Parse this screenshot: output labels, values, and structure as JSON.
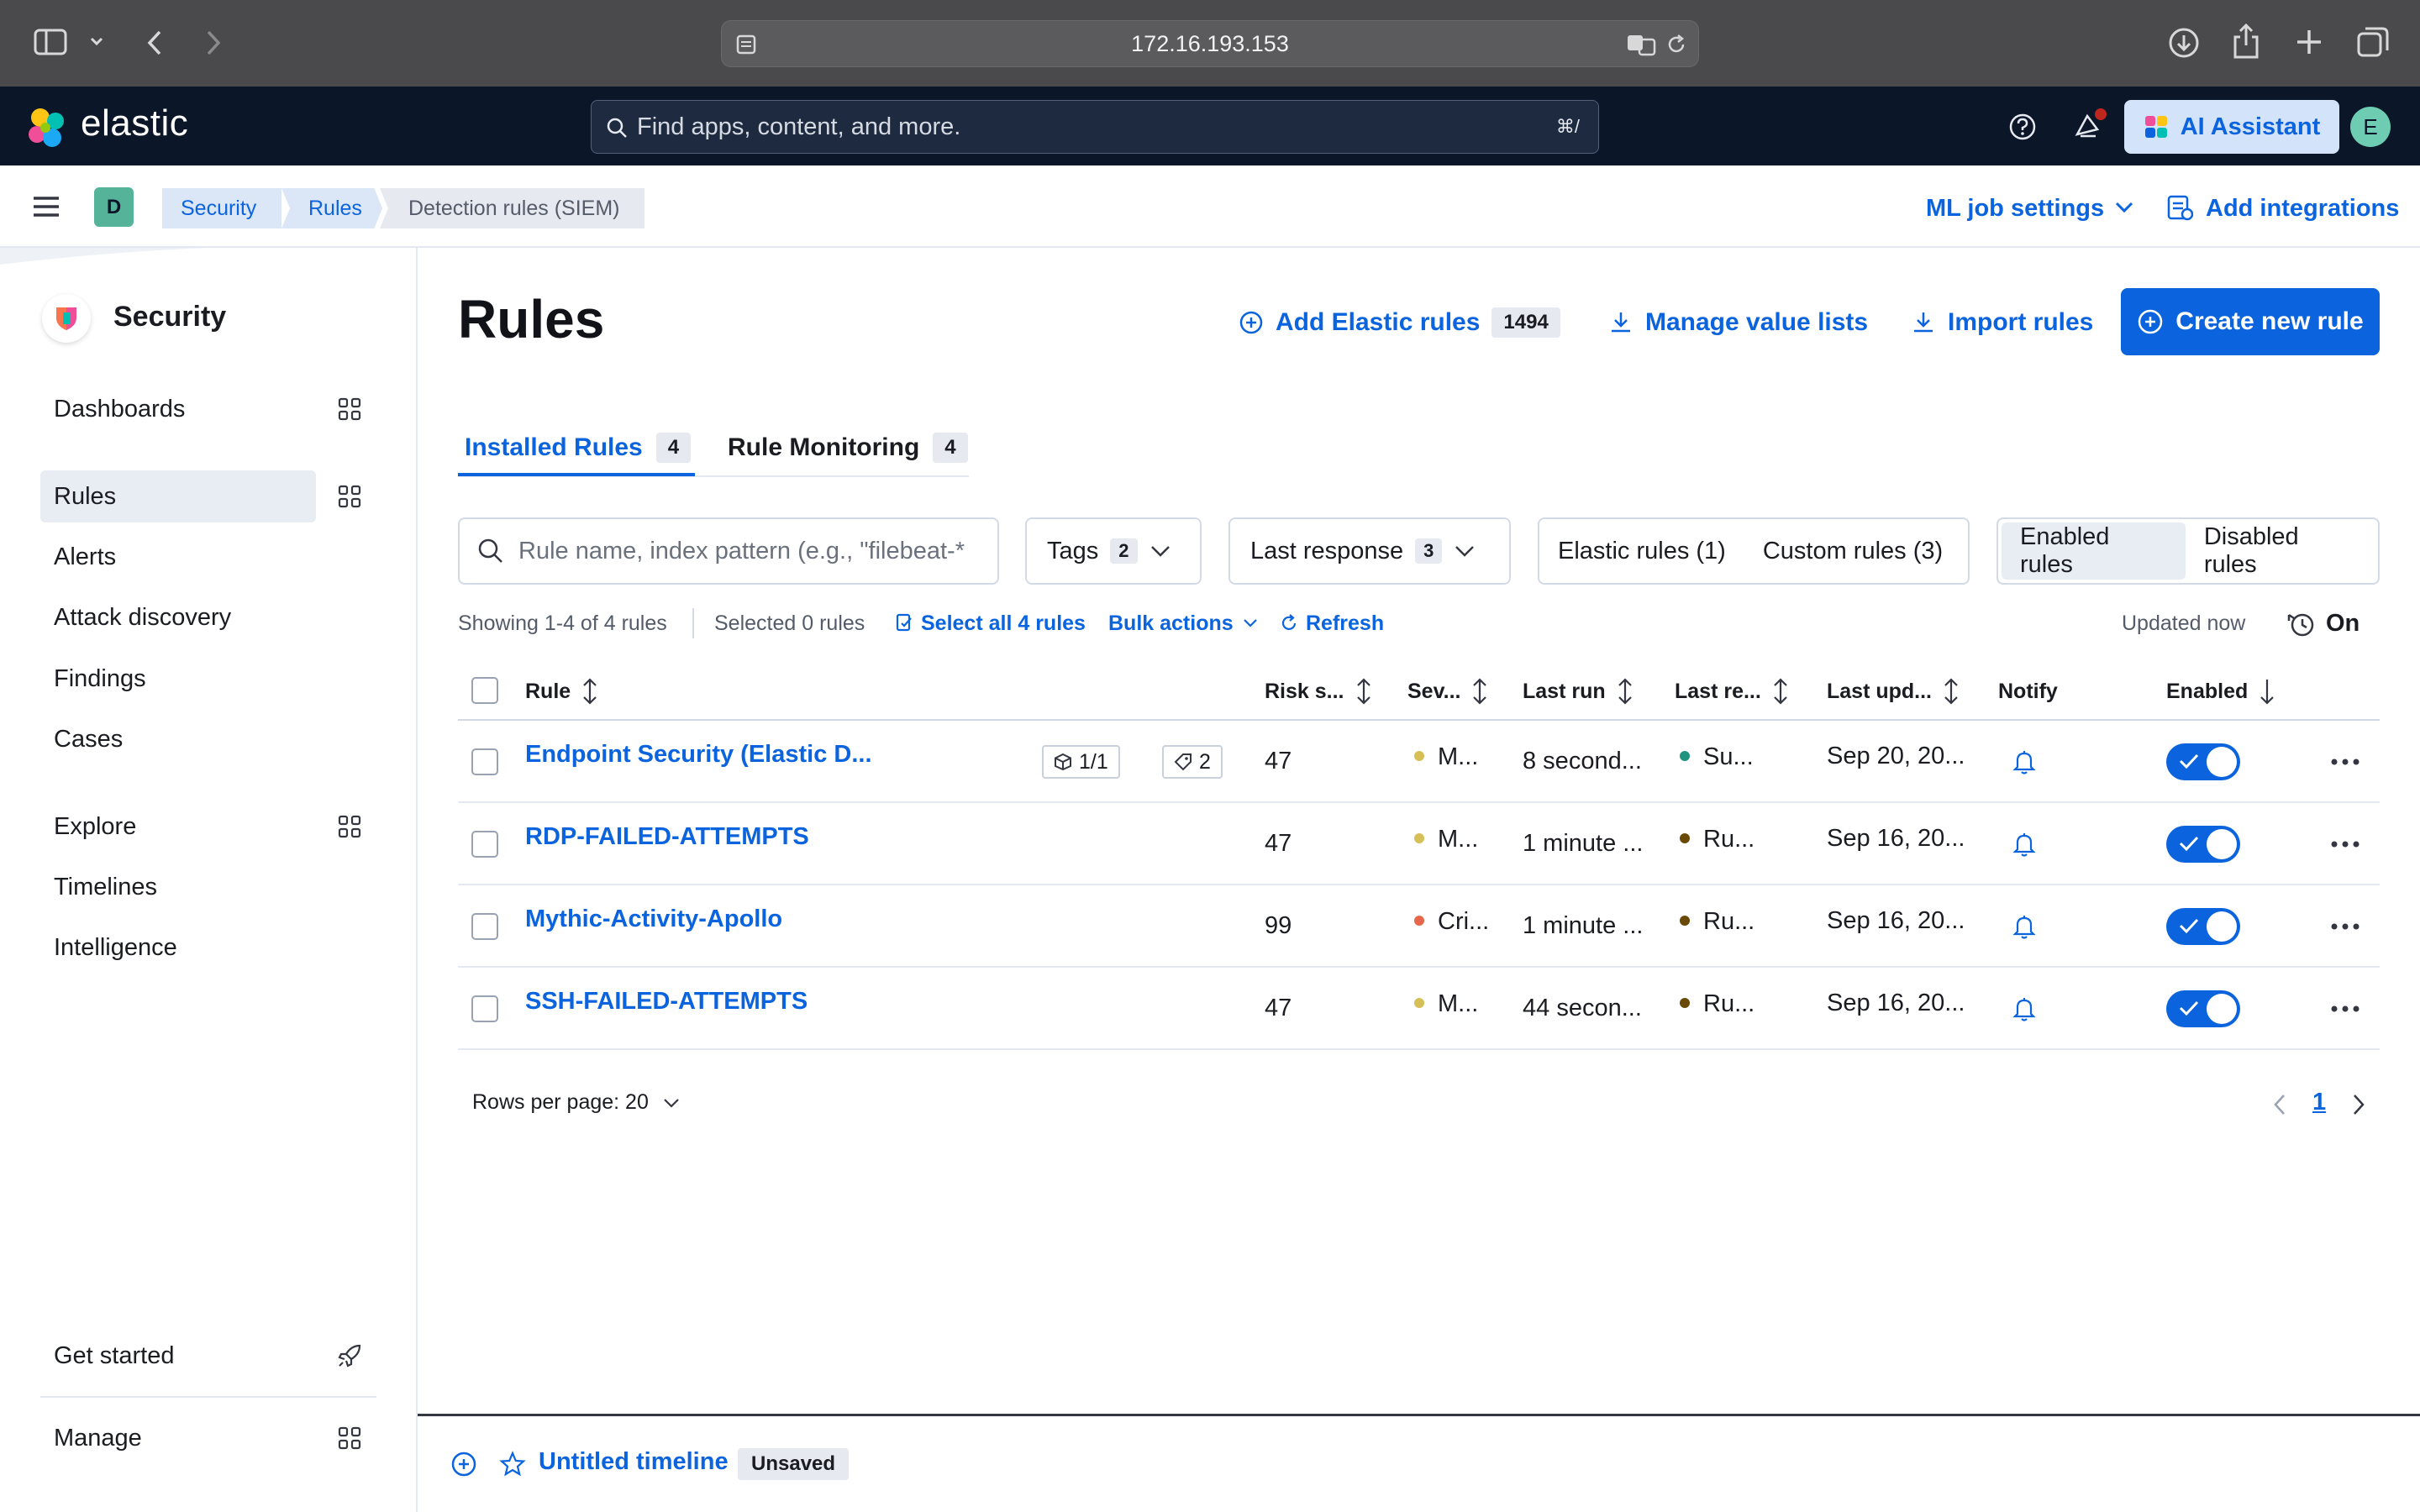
{
  "browser": {
    "url": "172.16.193.153"
  },
  "header": {
    "brand": "elastic",
    "search_placeholder": "Find apps, content, and more.",
    "search_shortcut": "⌘/",
    "ai_assistant_label": "AI Assistant",
    "user_initial": "E"
  },
  "breadcrumb_bar": {
    "space_initial": "D",
    "crumbs": [
      "Security",
      "Rules",
      "Detection rules (SIEM)"
    ],
    "ml_job_settings": "ML job settings",
    "add_integrations": "Add integrations"
  },
  "sidebar": {
    "title": "Security",
    "items": [
      "Dashboards",
      "Rules",
      "Alerts",
      "Attack discovery",
      "Findings",
      "Cases",
      "Explore",
      "Timelines",
      "Intelligence"
    ],
    "footer_items": [
      "Get started",
      "Manage"
    ],
    "active": "Rules"
  },
  "page": {
    "title": "Rules",
    "add_elastic_rules": "Add Elastic rules",
    "add_elastic_rules_count": "1494",
    "manage_value_lists": "Manage value lists",
    "import_rules": "Import rules",
    "create_new_rule": "Create new rule"
  },
  "tabs": [
    {
      "label": "Installed Rules",
      "count": "4",
      "active": true
    },
    {
      "label": "Rule Monitoring",
      "count": "4",
      "active": false
    }
  ],
  "filters": {
    "search_placeholder": "Rule name, index pattern (e.g., \"filebeat-*",
    "tags_label": "Tags",
    "tags_count": "2",
    "last_response_label": "Last response",
    "last_response_count": "3",
    "elastic_rules": "Elastic rules (1)",
    "custom_rules": "Custom rules (3)",
    "enabled_rules": "Enabled rules",
    "disabled_rules": "Disabled rules"
  },
  "utility": {
    "showing": "Showing 1-4 of 4 rules",
    "selected": "Selected 0 rules",
    "select_all": "Select all 4 rules",
    "bulk_actions": "Bulk actions",
    "refresh": "Refresh",
    "updated": "Updated now",
    "auto_refresh": "On"
  },
  "table": {
    "columns": [
      "Rule",
      "Risk s...",
      "Sev...",
      "Last run",
      "Last re...",
      "Last upd...",
      "Notify",
      "Enabled"
    ],
    "rows": [
      {
        "rule": "Endpoint Security (Elastic D...",
        "integrations": "1/1",
        "tags": "2",
        "risk": "47",
        "severity": "M...",
        "severity_color": "#d6bf57",
        "last_run": "8 second...",
        "last_response": "Su...",
        "response_color": "#209280",
        "last_updated": "Sep 20, 20...",
        "enabled": true
      },
      {
        "rule": "RDP-FAILED-ATTEMPTS",
        "risk": "47",
        "severity": "M...",
        "severity_color": "#d6bf57",
        "last_run": "1 minute ...",
        "last_response": "Ru...",
        "response_color": "#6a4906",
        "last_updated": "Sep 16, 20...",
        "enabled": true
      },
      {
        "rule": "Mythic-Activity-Apollo",
        "risk": "99",
        "severity": "Cri...",
        "severity_color": "#e7664c",
        "last_run": "1 minute ...",
        "last_response": "Ru...",
        "response_color": "#6a4906",
        "last_updated": "Sep 16, 20...",
        "enabled": true
      },
      {
        "rule": "SSH-FAILED-ATTEMPTS",
        "risk": "47",
        "severity": "M...",
        "severity_color": "#d6bf57",
        "last_run": "44 secon...",
        "last_response": "Ru...",
        "response_color": "#6a4906",
        "last_updated": "Sep 16, 20...",
        "enabled": true
      }
    ]
  },
  "pagination": {
    "rows_per_page": "Rows per page: 20",
    "current_page": "1"
  },
  "timeline": {
    "name": "Untitled timeline",
    "status": "Unsaved"
  },
  "colors": {
    "accent": "#0b64dd",
    "header_bg": "#0b1628"
  }
}
